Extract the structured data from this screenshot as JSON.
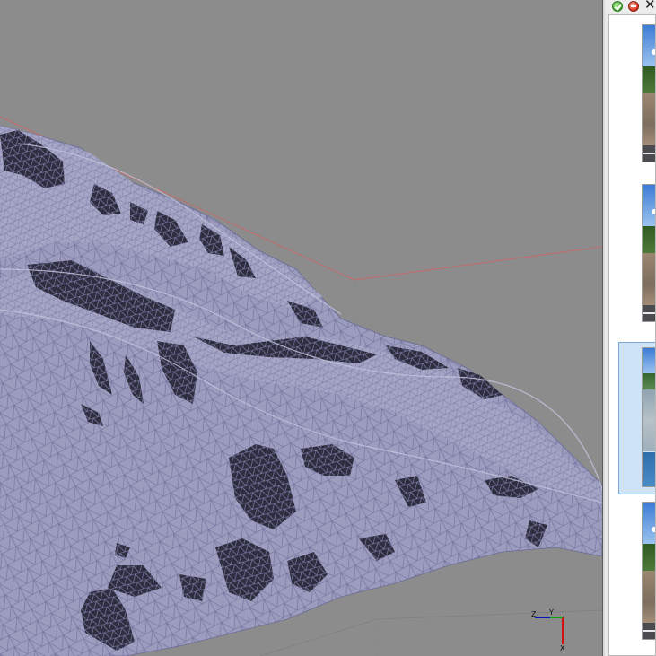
{
  "window": {
    "toolbar": {
      "ok_icon": "check-icon",
      "cancel_icon": "minus-icon",
      "close_label": "✕"
    }
  },
  "viewport": {
    "background": "#8c8c8c",
    "mesh_color": "#7b7ba8",
    "bounding_box_color": "#c07070",
    "axis": {
      "x_label": "X",
      "y_label": "Y",
      "z_label": "Z",
      "x_color": "#d01010",
      "y_color": "#10a010",
      "z_color": "#1010c0"
    }
  },
  "image_list": {
    "items": [
      {
        "id": "photo-1",
        "selected": false
      },
      {
        "id": "photo-2",
        "selected": false
      },
      {
        "id": "photo-3",
        "selected": true
      },
      {
        "id": "photo-4",
        "selected": false
      }
    ]
  }
}
